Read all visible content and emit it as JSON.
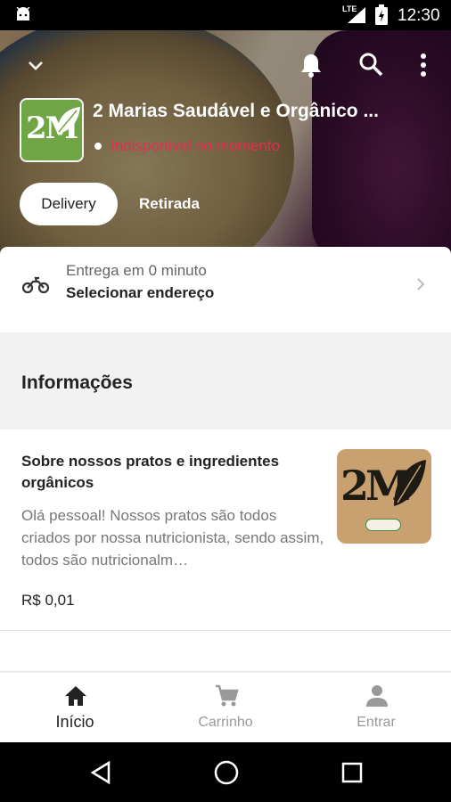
{
  "status_bar": {
    "network": "LTE",
    "time": "12:30"
  },
  "header": {
    "store_name": "2 Marias Saudável e Orgânico ...",
    "availability": "Indisponível no momento",
    "logo_text": "2M",
    "tabs": [
      {
        "label": "Delivery",
        "active": true
      },
      {
        "label": "Retirada",
        "active": false
      }
    ]
  },
  "delivery": {
    "time_text": "Entrega em 0 minuto",
    "address_action": "Selecionar endereço"
  },
  "section": {
    "title": "Informações"
  },
  "info_card": {
    "title": "Sobre nossos pratos e ingredientes orgânicos",
    "description": "Olá pessoal! Nossos pratos são todos criados por nossa nutricionista, sendo assim, todos são nutricionalm…",
    "price": "R$ 0,01",
    "thumb_text": "2M"
  },
  "bottom_nav": [
    {
      "label": "Início",
      "icon": "home-icon",
      "active": true
    },
    {
      "label": "Carrinho",
      "icon": "cart-icon",
      "active": false
    },
    {
      "label": "Entrar",
      "icon": "person-icon",
      "active": false
    }
  ],
  "colors": {
    "unavailable": "#e0304e",
    "logo_green": "#6fa545"
  }
}
